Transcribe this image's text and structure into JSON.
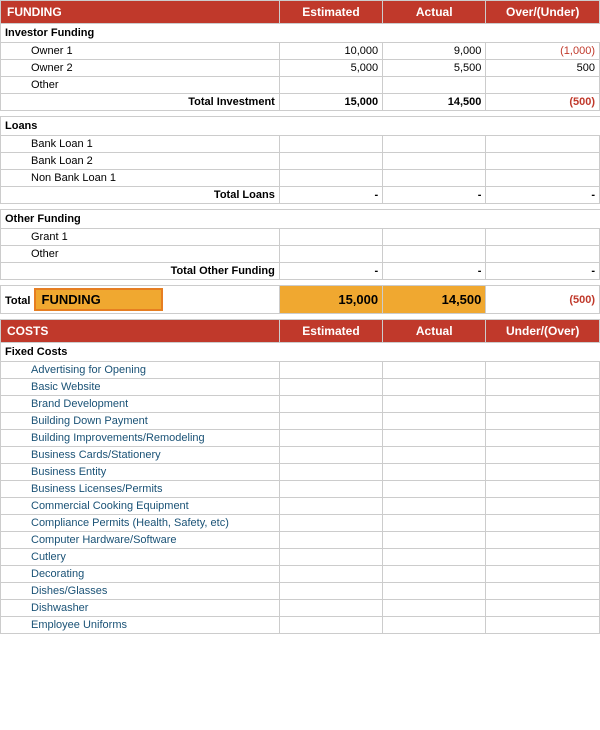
{
  "funding": {
    "header": {
      "section": "FUNDING",
      "estimated": "Estimated",
      "actual": "Actual",
      "over_under": "Over/(Under)"
    },
    "investor_funding": {
      "label": "Investor Funding",
      "rows": [
        {
          "name": "Owner 1",
          "estimated": "10,000",
          "actual": "9,000",
          "over_under": "(1,000)",
          "over_under_red": true
        },
        {
          "name": "Owner 2",
          "estimated": "5,000",
          "actual": "5,500",
          "over_under": "500",
          "over_under_red": false
        },
        {
          "name": "Other",
          "estimated": "",
          "actual": "",
          "over_under": "",
          "over_under_red": false
        }
      ],
      "total_label": "Total Investment",
      "total_estimated": "15,000",
      "total_actual": "14,500",
      "total_over_under": "(500)",
      "total_red": true
    },
    "loans": {
      "label": "Loans",
      "rows": [
        {
          "name": "Bank Loan 1",
          "estimated": "",
          "actual": "",
          "over_under": ""
        },
        {
          "name": "Bank Loan 2",
          "estimated": "",
          "actual": "",
          "over_under": ""
        },
        {
          "name": "Non Bank Loan 1",
          "estimated": "",
          "actual": "",
          "over_under": ""
        }
      ],
      "total_label": "Total Loans",
      "total_estimated": "-",
      "total_actual": "-",
      "total_over_under": "-"
    },
    "other_funding": {
      "label": "Other Funding",
      "rows": [
        {
          "name": "Grant 1",
          "estimated": "",
          "actual": "",
          "over_under": ""
        },
        {
          "name": "Other",
          "estimated": "",
          "actual": "",
          "over_under": ""
        }
      ],
      "total_label": "Total Other Funding",
      "total_estimated": "-",
      "total_actual": "-",
      "total_over_under": "-"
    },
    "grand_total": {
      "label": "Total",
      "highlight": "FUNDING",
      "estimated": "15,000",
      "actual": "14,500",
      "over_under": "(500)",
      "over_under_red": true
    }
  },
  "costs": {
    "header": {
      "section": "COSTS",
      "estimated": "Estimated",
      "actual": "Actual",
      "under_over": "Under/(Over)"
    },
    "fixed_costs": {
      "label": "Fixed Costs",
      "items": [
        "Advertising for Opening",
        "Basic Website",
        "Brand Development",
        "Building Down Payment",
        "Building Improvements/Remodeling",
        "Business Cards/Stationery",
        "Business Entity",
        "Business Licenses/Permits",
        "Commercial Cooking Equipment",
        "Compliance Permits (Health, Safety, etc)",
        "Computer Hardware/Software",
        "Cutlery",
        "Decorating",
        "Dishes/Glasses",
        "Dishwasher",
        "Employee Uniforms"
      ]
    }
  }
}
